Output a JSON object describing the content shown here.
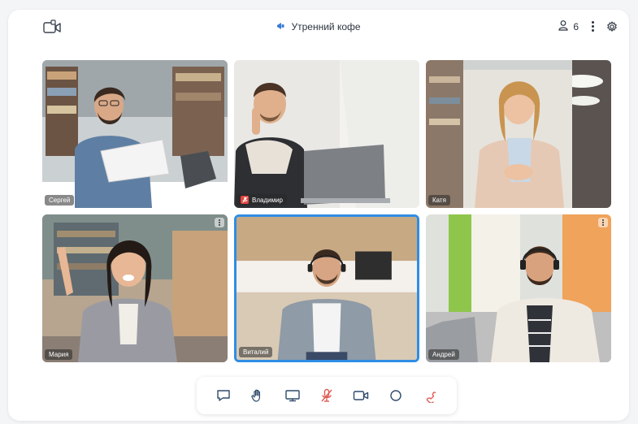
{
  "header": {
    "title": "Утренний кофе",
    "participants_count": "6",
    "left_icon": "video-call-icon",
    "title_icon": "megaphone-icon",
    "participants_icon": "participants-icon",
    "menu_icon": "more-vertical-icon",
    "settings_icon": "gear-icon"
  },
  "participants": [
    {
      "name": "Сергей",
      "muted": false,
      "active": false,
      "has_menu": false
    },
    {
      "name": "Владимир",
      "muted": true,
      "active": false,
      "has_menu": false
    },
    {
      "name": "Катя",
      "muted": false,
      "active": false,
      "has_menu": false
    },
    {
      "name": "Мария",
      "muted": false,
      "active": false,
      "has_menu": true
    },
    {
      "name": "Виталий",
      "muted": false,
      "active": true,
      "has_menu": false
    },
    {
      "name": "Андрей",
      "muted": false,
      "active": false,
      "has_menu": true
    }
  ],
  "toolbar": {
    "buttons": [
      {
        "icon": "chat-icon"
      },
      {
        "icon": "raise-hand-icon"
      },
      {
        "icon": "screen-share-icon"
      },
      {
        "icon": "mic-off-icon"
      },
      {
        "icon": "camera-icon"
      },
      {
        "icon": "record-icon"
      },
      {
        "icon": "end-call-icon"
      }
    ]
  },
  "colors": {
    "accent": "#2f8de4",
    "muted_badge": "#e3453f",
    "end_call": "#e05a55",
    "icon_blue": "#3a7bd5"
  }
}
